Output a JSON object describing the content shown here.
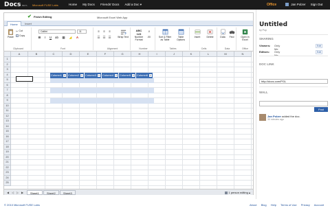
{
  "topbar": {
    "logo": "Docs",
    "beta": "BETA",
    "lab": "Microsoft FUSE Labs",
    "nav": [
      "Home",
      "My Docs",
      "Friends' Docs",
      "Add a Doc ▾"
    ],
    "office": "Office",
    "user": "Jan Polzer",
    "signout": "Sign Out"
  },
  "excel": {
    "finish_editing": "Finish Editing",
    "app_title": "Microsoft Excel Web App",
    "tabs": [
      "Home",
      "Insert"
    ],
    "ribbon": {
      "paste": "Paste",
      "cut": "Cut",
      "copy": "Copy",
      "font_name": "Calibri",
      "font_size": "11",
      "wrap_text": "Wrap Text",
      "number_format": "Number Format",
      "number_format_sample": "ABC 123",
      "sort_filter": "Sort & Filter as Table",
      "table_options": "Table Options",
      "insert": "Insert",
      "delete": "Delete",
      "data": "Data",
      "find": "Find",
      "open_in_excel": "Open in Excel",
      "groups": [
        "Clipboard",
        "Font",
        "Alignment",
        "Number",
        "Tables",
        "Cells",
        "Data",
        "Office"
      ]
    },
    "columns": [
      "A",
      "B",
      "C",
      "D",
      "E",
      "F",
      "G",
      "H",
      "I",
      "J",
      "K",
      "L",
      "M",
      "N"
    ],
    "rows": [
      "1",
      "2",
      "3",
      "4",
      "5",
      "6",
      "7",
      "8",
      "9",
      "10",
      "11",
      "12",
      "13",
      "14",
      "15",
      "16",
      "17",
      "18",
      "19",
      "20",
      "21",
      "22",
      "23",
      "24",
      "25"
    ],
    "table_headers": [
      "Column1",
      "Column2",
      "Column3",
      "Column4",
      "Column5",
      "Column6"
    ],
    "sheets": [
      "Sheet1",
      "Sheet2",
      "Sheet3"
    ],
    "editing_status": "1 person editing"
  },
  "side": {
    "title": "Untitled",
    "by": "by Pop",
    "sharing_heading": "SHARING",
    "viewers_label": "Viewers:",
    "viewers_value": "Only Me",
    "editors_label": "Editors:",
    "editors_value": "Only Me",
    "edit_label": "Edit",
    "doc_link_heading": "DOC LINK",
    "doc_link_value": "http://docs.com/PGL",
    "wall_heading": "WALL",
    "post_label": "Post",
    "feed_user": "Jan Polzer",
    "feed_action": "added the doc.",
    "feed_time": "30 minutes ago"
  },
  "footer": {
    "copyright": "© 2010 Microsoft FUSE Labs",
    "links": [
      "About",
      "Blog",
      "Help",
      "Terms of Use",
      "Privacy",
      "Account"
    ]
  },
  "colors": {
    "topbar": "#1b1b1b",
    "accent": "#f29a2e",
    "table_header": "#3b6db3",
    "table_band": "#d6e1f2",
    "link": "#1d4f9a"
  }
}
